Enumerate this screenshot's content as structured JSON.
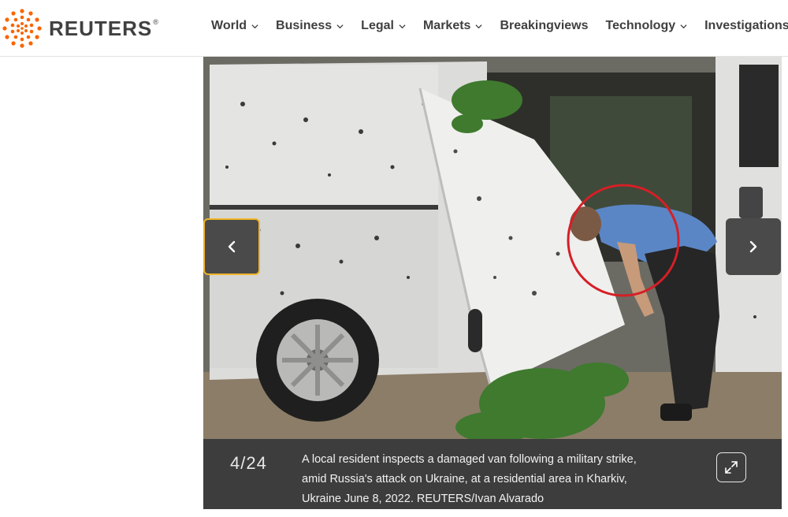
{
  "brand": {
    "name": "REUTERS",
    "registered": "®",
    "accent_color": "#fa6400"
  },
  "nav": {
    "items": [
      {
        "label": "World",
        "has_dropdown": true
      },
      {
        "label": "Business",
        "has_dropdown": true
      },
      {
        "label": "Legal",
        "has_dropdown": true
      },
      {
        "label": "Markets",
        "has_dropdown": true
      },
      {
        "label": "Breakingviews",
        "has_dropdown": false
      },
      {
        "label": "Technology",
        "has_dropdown": true
      },
      {
        "label": "Investigations",
        "has_dropdown": false
      }
    ]
  },
  "gallery": {
    "counter": "4/24",
    "caption": "A local resident inspects a damaged van following a military strike, amid Russia's attack on Ukraine, at a residential area in Kharkiv, Ukraine June 8, 2022. REUTERS/Ivan Alvarado",
    "prev_icon": "chevron-left-icon",
    "next_icon": "chevron-right-icon",
    "expand_icon": "expand-icon",
    "highlight_color": "#f0b429"
  }
}
